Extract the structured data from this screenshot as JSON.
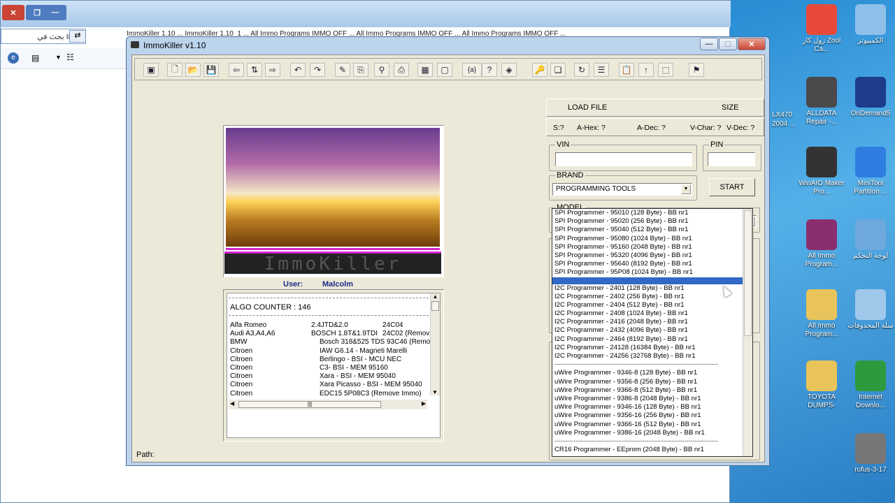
{
  "background_window": {
    "search_text": "بحث في Im...",
    "tabs_text": "ImmoKiller 1.10 ...    ImmoKiller 1.10_1 ...    All Immo Programs IMMO OFF ...    All Immo Programs IMMO OFF ...    All Immo Programs IMMO OFF ...",
    "close_label": "✕",
    "restore_label": "❐",
    "minimize_label": "—"
  },
  "desktop_icons": [
    {
      "label": "زول كار Zool Ca...",
      "icon": "chrome-icon",
      "color": "#e84a3a"
    },
    {
      "label": "الكمبيوتر",
      "icon": "computer-icon",
      "color": "#8fc0ea"
    },
    {
      "label": "ALLDATA Repair -...",
      "icon": "tools-icon",
      "color": "#4a4a4a"
    },
    {
      "label": "OnDemand5",
      "icon": "od5-icon",
      "color": "#1d3c8a"
    },
    {
      "label": "WinAIO Maker Pro...",
      "icon": "dvd-icon",
      "color": "#333"
    },
    {
      "label": "MiniTool Partition ...",
      "icon": "minitool-icon",
      "color": "#2f7de0"
    },
    {
      "label": "All Immo Program...",
      "icon": "winrar-icon",
      "color": "#8a2f6e"
    },
    {
      "label": "لوحة التحكم",
      "icon": "control-panel-icon",
      "color": "#6fa8dc"
    },
    {
      "label": "All Immo Program...",
      "icon": "folder-icon",
      "color": "#e8c45a"
    },
    {
      "label": "سلة المحذوفات",
      "icon": "recycle-bin-icon",
      "color": "#9fc8ea"
    },
    {
      "label": "TOYOTA DUMPS-",
      "icon": "folder-icon",
      "color": "#e8c45a"
    },
    {
      "label": "Internet Downlo...",
      "icon": "idm-icon",
      "color": "#2e9a3e"
    },
    {
      "label": "rufus-3-17",
      "icon": "usb-icon",
      "color": "#777"
    }
  ],
  "partial_icon_text": "LX470 2004 ...",
  "app": {
    "title": "ImmoKiller v1.10",
    "user_label": "User:",
    "user_name": "Malcolm",
    "led_text": "ImmoKiller",
    "algo_counter": "ALGO COUNTER : 146",
    "path_label": "Path:",
    "load_file_label": "LOAD FILE",
    "size_label": "SIZE",
    "stats": {
      "s": "S:?",
      "ahex": "A-Hex: ?",
      "adec": "A-Dec: ?",
      "vchar": "V-Char: ?",
      "vdec": "V-Dec: ?"
    },
    "vin_label": "VIN",
    "pin_label": "PIN",
    "brand_label": "BRAND",
    "brand_value": "PROGRAMMING TOOLS",
    "start_label": "START",
    "model_label": "MODEL",
    "model_value": "",
    "toolbar_icons": [
      "exit-icon",
      "new-file-icon",
      "open-folder-icon",
      "save-icon",
      "import-icon",
      "swap-icon",
      "export-icon",
      "undo-icon",
      "redo-icon",
      "edit-icon",
      "calc-icon",
      "binoculars-icon",
      "print-icon",
      "calculator-icon",
      "window-icon",
      "brace-icon",
      "help-icon",
      "book-icon",
      "key-icon",
      "copy-icon",
      "refresh-icon",
      "list-icon",
      "paste-icon",
      "up-icon",
      "select-icon",
      "pin-icon"
    ],
    "toolbar_glyphs": [
      "▣",
      "🗋",
      "📂",
      "💾",
      "⇦",
      "⇅",
      "⇨",
      "↶",
      "↷",
      "✎",
      "⎘",
      "⚲",
      "⎙",
      "▦",
      "▢",
      "{a}",
      "?",
      "◈",
      "🔑",
      "❏",
      "↻",
      "☰",
      "📋",
      "↑",
      "⬚",
      "⚑"
    ],
    "list_rows": [
      {
        "make": "Alfa Romeo",
        "c2": "2.4JTD&2.0",
        "c3": "24C04"
      },
      {
        "make": "Audi A3,A4,A6",
        "c2": "BOSCH 1.8T&1.9TDI",
        "c3": "24C02 (Remov"
      },
      {
        "make": "BMW",
        "c2": "Bosch 318&525 TDS 93C46 (Remove",
        "c3": ""
      },
      {
        "make": "Citroen",
        "c2": "IAW G6.14 - Magneti Marelli",
        "c3": ""
      },
      {
        "make": "Citroen",
        "c2": "Berlingo - BSI - MCU NEC",
        "c3": ""
      },
      {
        "make": "Citroen",
        "c2": "C3- BSI - MEM 95160",
        "c3": ""
      },
      {
        "make": "Citroen",
        "c2": "Xara - BSI - MEM 95040",
        "c3": ""
      },
      {
        "make": "Citroen",
        "c2": "Xara Picasso    - BSI - MEM 95040",
        "c3": ""
      },
      {
        "make": "Citroen",
        "c2": "EDC15 5P08C3 (Remove Immo)",
        "c3": ""
      }
    ],
    "model_options": [
      {
        "text": "SPI     Programmer - 95010 (128  Byte) - BB nr1",
        "type": "opt"
      },
      {
        "text": "SPI     Programmer - 95020 (256  Byte) - BB nr1",
        "type": "opt"
      },
      {
        "text": "SPI     Programmer - 95040 (512  Byte) - BB nr1",
        "type": "opt"
      },
      {
        "text": "SPI     Programmer - 95080 (1024 Byte) - BB nr1",
        "type": "opt"
      },
      {
        "text": "SPI     Programmer - 95160 (2048 Byte) - BB nr1",
        "type": "opt"
      },
      {
        "text": "SPI     Programmer - 95320 (4096 Byte) - BB nr1",
        "type": "opt"
      },
      {
        "text": "SPI     Programmer - 95640 (8192 Byte) - BB nr1",
        "type": "opt"
      },
      {
        "text": "SPI     Programmer - 95P08 (1024 Byte) - BB nr1",
        "type": "opt"
      },
      {
        "text": "",
        "type": "sel"
      },
      {
        "text": "I2C     Programmer - 2401 (128  Byte)  - BB nr1",
        "type": "opt"
      },
      {
        "text": "I2C     Programmer - 2402 (256  Byte)  - BB nr1",
        "type": "opt"
      },
      {
        "text": "I2C     Programmer - 2404 (512  Byte)  - BB nr1",
        "type": "opt"
      },
      {
        "text": "I2C     Programmer - 2408 (1024 Byte)  - BB nr1",
        "type": "opt"
      },
      {
        "text": "I2C     Programmer - 2416 (2048 Byte)  - BB nr1",
        "type": "opt"
      },
      {
        "text": "I2C     Programmer - 2432 (4096 Byte)  - BB nr1",
        "type": "opt"
      },
      {
        "text": "I2C     Programmer - 2464 (8192 Byte)  - BB nr1",
        "type": "opt"
      },
      {
        "text": "I2C     Programmer - 24128 (16384 Byte) - BB nr1",
        "type": "opt"
      },
      {
        "text": "I2C     Programmer - 24256 (32768 Byte) - BB nr1",
        "type": "opt"
      },
      {
        "text": "------------------------------------------------------------------------------",
        "type": "sep"
      },
      {
        "text": "uWire Programmer - 9346-8  (128  Byte) - BB nr1",
        "type": "opt"
      },
      {
        "text": "uWire Programmer - 9356-8  (256  Byte) - BB nr1",
        "type": "opt"
      },
      {
        "text": "uWire Programmer - 9366-8  (512  Byte) - BB nr1",
        "type": "opt"
      },
      {
        "text": "uWire Programmer - 9386-8  (2048 Byte) - BB nr1",
        "type": "opt"
      },
      {
        "text": "uWire Programmer - 9346-16 (128  Byte) - BB nr1",
        "type": "opt"
      },
      {
        "text": "uWire Programmer - 9356-16 (256  Byte) - BB nr1",
        "type": "opt"
      },
      {
        "text": "uWire Programmer - 9366-16 (512  Byte) - BB nr1",
        "type": "opt"
      },
      {
        "text": "uWire Programmer - 9386-16 (2048 Byte) - BB nr1",
        "type": "opt"
      },
      {
        "text": "------------------------------------------------------------------------------",
        "type": "sep"
      },
      {
        "text": "CR16  Programmer - EEprom  (2048 Byte) - BB nr1",
        "type": "opt"
      }
    ]
  }
}
